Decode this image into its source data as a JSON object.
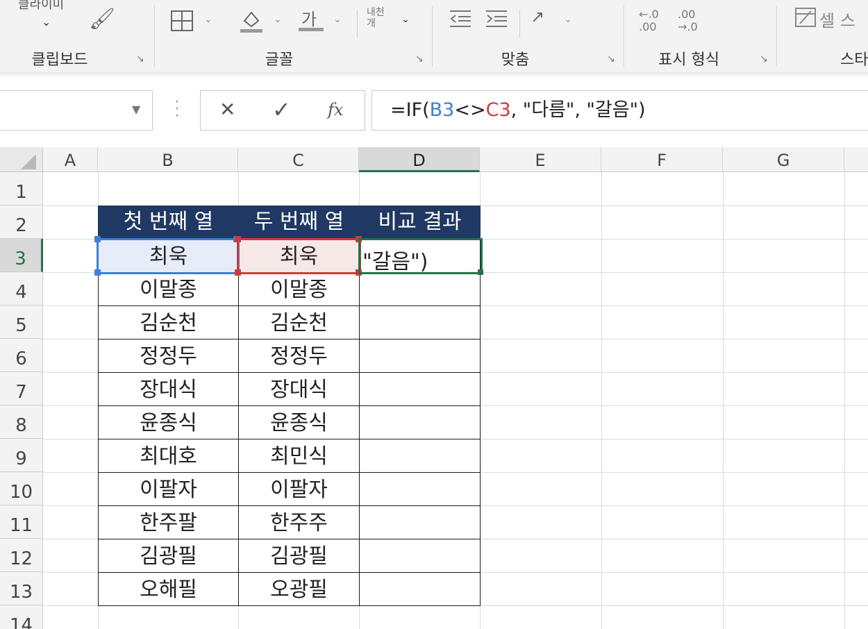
{
  "ribbon": {
    "clipboard": {
      "label": "클립보드",
      "top_text": "클라이미"
    },
    "font": {
      "label": "글꼴",
      "font_color_glyph": "가"
    },
    "alignment": {
      "label": "맞춤",
      "wrap_text": "내천\n개"
    },
    "number": {
      "label": "표시 형식",
      "inc_decimal": "←.0\n.00",
      "dec_decimal": ".00\n→.0"
    },
    "styles": {
      "cell_styles": "셀 스",
      "label": "스타"
    }
  },
  "formula_bar": {
    "name_box": "",
    "cancel_glyph": "✕",
    "enter_glyph": "✓",
    "fx_glyph": "fx",
    "formula_prefix": "=IF(",
    "ref_b": "B3",
    "op": "<>",
    "ref_c": "C3",
    "formula_suffix": ", \"다름\", \"갈음\")"
  },
  "sheet": {
    "columns": [
      "A",
      "B",
      "C",
      "D",
      "E",
      "F",
      "G"
    ],
    "active_column": "D",
    "rows": [
      "1",
      "2",
      "3",
      "4",
      "5",
      "6",
      "7",
      "8",
      "9",
      "10",
      "11",
      "12",
      "13",
      "14"
    ],
    "active_row": "3",
    "headers": [
      "첫 번째 열",
      "두 번째 열",
      "비교 결과"
    ],
    "data": [
      [
        "최욱",
        "최욱",
        "\"갈음\")"
      ],
      [
        "이말종",
        "이말종",
        ""
      ],
      [
        "김순천",
        "김순천",
        ""
      ],
      [
        "정정두",
        "정정두",
        ""
      ],
      [
        "장대식",
        "장대식",
        ""
      ],
      [
        "윤종식",
        "윤종식",
        ""
      ],
      [
        "최대호",
        "최민식",
        ""
      ],
      [
        "이팔자",
        "이팔자",
        ""
      ],
      [
        "한주팔",
        "한주주",
        ""
      ],
      [
        "김광필",
        "김광필",
        ""
      ],
      [
        "오해필",
        "오광필",
        ""
      ]
    ]
  }
}
